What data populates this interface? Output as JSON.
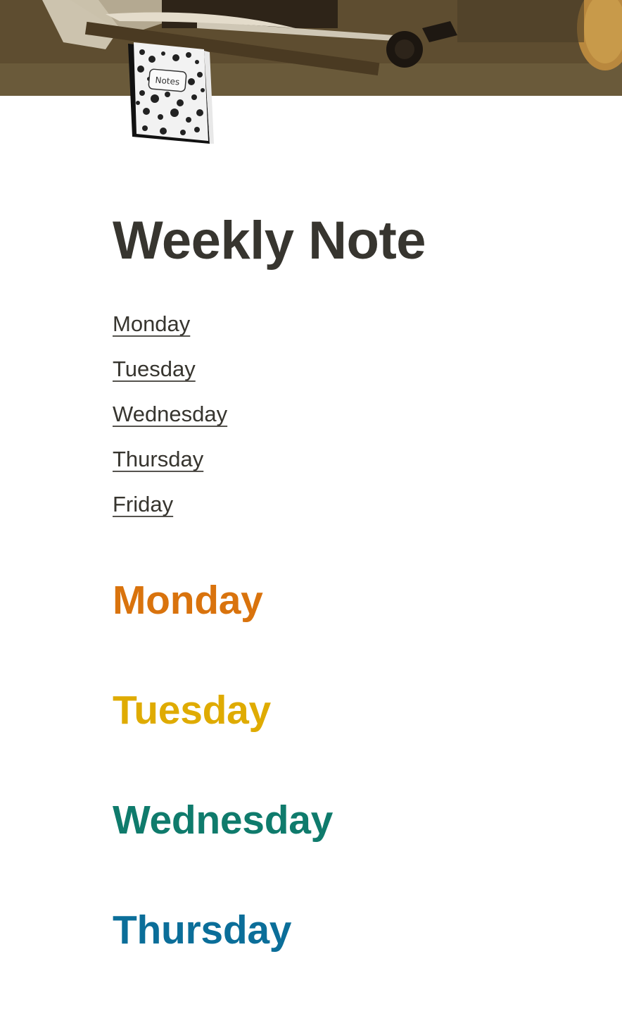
{
  "page": {
    "title": "Weekly Note",
    "icon": "composition-notebook-icon",
    "icon_label": "Notes"
  },
  "cover": {
    "subject": "still-life-painting"
  },
  "toc": {
    "items": [
      {
        "label": "Monday"
      },
      {
        "label": "Tuesday"
      },
      {
        "label": "Wednesday"
      },
      {
        "label": "Thursday"
      },
      {
        "label": "Friday"
      }
    ]
  },
  "headings": [
    {
      "label": "Monday",
      "color": "#d9730d"
    },
    {
      "label": "Tuesday",
      "color": "#dfab01"
    },
    {
      "label": "Wednesday",
      "color": "#0f7b6c"
    },
    {
      "label": "Thursday",
      "color": "#0b6e99"
    }
  ],
  "colors": {
    "text": "#37352f",
    "background": "#ffffff"
  }
}
